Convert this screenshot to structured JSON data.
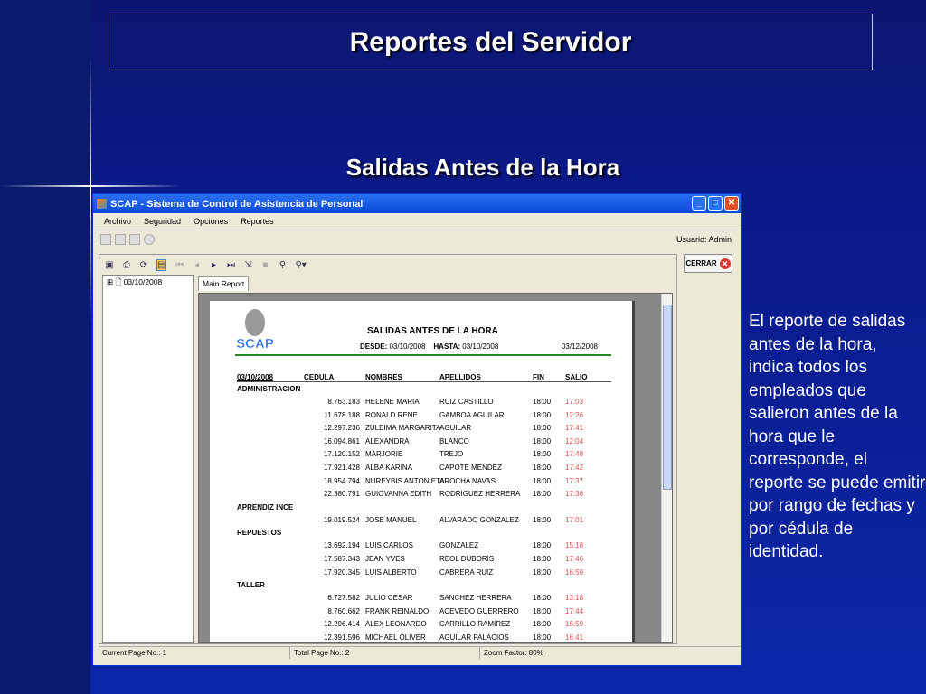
{
  "slide": {
    "title": "Reportes del Servidor",
    "subtitle": "Salidas Antes de la Hora",
    "description": "El reporte de salidas antes de la hora, indica todos los empleados que salieron antes de la hora que le corresponde, el reporte se puede emitir por rango de fechas y por cédula de identidad."
  },
  "window": {
    "title": "SCAP - Sistema de Control de Asistencia de Personal",
    "menu": [
      "Archivo",
      "Seguridad",
      "Opciones",
      "Reportes"
    ],
    "user": "Usuario: Admin",
    "close_button": "CERRAR"
  },
  "viewer": {
    "tree_item": "03/10/2008",
    "tab": "Main Report",
    "status": {
      "current": "Current Page No.: 1",
      "total": "Total Page No.: 2",
      "zoom": "Zoom Factor: 80%"
    }
  },
  "report": {
    "logo": "SCAP",
    "title": "SALIDAS ANTES DE LA HORA",
    "desde_label": "DESDE:",
    "desde": "03/10/2008",
    "hasta_label": "HASTA:",
    "hasta": "03/10/2008",
    "print_date": "03/12/2008",
    "headers": {
      "date": "03/10/2008",
      "cedula": "CEDULA",
      "nombres": "NOMBRES",
      "apellidos": "APELLIDOS",
      "fin": "FIN",
      "salio": "SALIO"
    },
    "groups": [
      {
        "name": "ADMINISTRACION",
        "rows": [
          [
            "8.763.183",
            "HELENE MARIA",
            "RUIZ CASTILLO",
            "18:00",
            "17:03"
          ],
          [
            "11.678.188",
            "RONALD RENE",
            "GAMBOA AGUILAR",
            "18:00",
            "12:26"
          ],
          [
            "12.297.236",
            "ZULEIMA MARGARITA",
            "AGUILAR",
            "18:00",
            "17:41"
          ],
          [
            "16.094.861",
            "ALEXANDRA",
            "BLANCO",
            "18:00",
            "12:04"
          ],
          [
            "17.120.152",
            "MARJORIE",
            "TREJO",
            "18:00",
            "17:48"
          ],
          [
            "17.921.428",
            "ALBA KARINA",
            "CAPOTE MENDEZ",
            "18:00",
            "17:42"
          ],
          [
            "18.954.794",
            "NUREYBIS ANTONIETA",
            "AROCHA NAVAS",
            "18:00",
            "17:37"
          ],
          [
            "22.380.791",
            "GUIOVANNA EDITH",
            "RODRIGUEZ HERRERA",
            "18:00",
            "17:38"
          ]
        ]
      },
      {
        "name": "APRENDIZ INCE",
        "rows": [
          [
            "19.019.524",
            "JOSE MANUEL",
            "ALVARADO GONZALEZ",
            "18:00",
            "17:01"
          ]
        ]
      },
      {
        "name": "REPUESTOS",
        "rows": [
          [
            "13.692.194",
            "LUIS CARLOS",
            "GONZALEZ",
            "18:00",
            "15:18"
          ],
          [
            "17.587.343",
            "JEAN YVES",
            "REOL DUBORIS",
            "18:00",
            "17:46"
          ],
          [
            "17.920.345",
            "LUIS ALBERTO",
            "CABRERA RUIZ",
            "18:00",
            "16:59"
          ]
        ]
      },
      {
        "name": "TALLER",
        "rows": [
          [
            "6.727.582",
            "JULIO CESAR",
            "SANCHEZ HERRERA",
            "18:00",
            "13:18"
          ],
          [
            "8.760.662",
            "FRANK REINALDO",
            "ACEVEDO GUERRERO",
            "18:00",
            "17:44"
          ],
          [
            "12.296.414",
            "ALEX LEONARDO",
            "CARRILLO RAMIREZ",
            "18:00",
            "16:59"
          ],
          [
            "12.391.596",
            "MICHAEL OLIVER",
            "AGUILAR PALACIOS",
            "18:00",
            "16:41"
          ]
        ]
      }
    ]
  }
}
